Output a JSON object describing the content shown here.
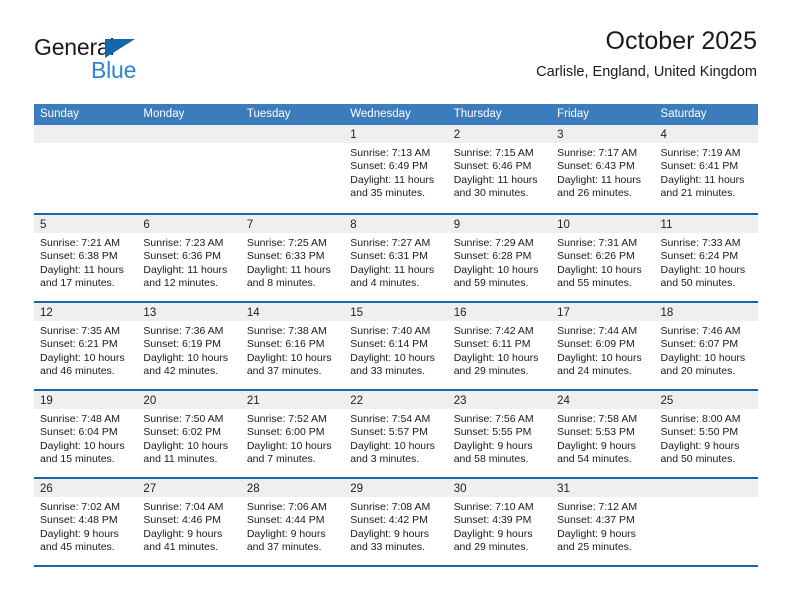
{
  "brand": {
    "word_one": "General",
    "word_two": "Blue",
    "triangle_icon": "triangle-logo-icon",
    "colors": {
      "dark_blue": "#1567ac",
      "light_blue": "#2f82d4"
    }
  },
  "header": {
    "title": "October 2025",
    "subtitle": "Carlisle, England, United Kingdom"
  },
  "calendar": {
    "accent_color": "#1567ac",
    "weekday_header_color": "#3b7cbd",
    "daynum_band_color": "#efefef",
    "weekdays": [
      "Sunday",
      "Monday",
      "Tuesday",
      "Wednesday",
      "Thursday",
      "Friday",
      "Saturday"
    ],
    "weeks": [
      [
        {
          "day": "",
          "sunrise": "",
          "sunset": "",
          "daylight": "",
          "empty": true
        },
        {
          "day": "",
          "sunrise": "",
          "sunset": "",
          "daylight": "",
          "empty": true
        },
        {
          "day": "",
          "sunrise": "",
          "sunset": "",
          "daylight": "",
          "empty": true
        },
        {
          "day": "1",
          "sunrise": "Sunrise: 7:13 AM",
          "sunset": "Sunset: 6:49 PM",
          "daylight": "Daylight: 11 hours and 35 minutes."
        },
        {
          "day": "2",
          "sunrise": "Sunrise: 7:15 AM",
          "sunset": "Sunset: 6:46 PM",
          "daylight": "Daylight: 11 hours and 30 minutes."
        },
        {
          "day": "3",
          "sunrise": "Sunrise: 7:17 AM",
          "sunset": "Sunset: 6:43 PM",
          "daylight": "Daylight: 11 hours and 26 minutes."
        },
        {
          "day": "4",
          "sunrise": "Sunrise: 7:19 AM",
          "sunset": "Sunset: 6:41 PM",
          "daylight": "Daylight: 11 hours and 21 minutes."
        }
      ],
      [
        {
          "day": "5",
          "sunrise": "Sunrise: 7:21 AM",
          "sunset": "Sunset: 6:38 PM",
          "daylight": "Daylight: 11 hours and 17 minutes."
        },
        {
          "day": "6",
          "sunrise": "Sunrise: 7:23 AM",
          "sunset": "Sunset: 6:36 PM",
          "daylight": "Daylight: 11 hours and 12 minutes."
        },
        {
          "day": "7",
          "sunrise": "Sunrise: 7:25 AM",
          "sunset": "Sunset: 6:33 PM",
          "daylight": "Daylight: 11 hours and 8 minutes."
        },
        {
          "day": "8",
          "sunrise": "Sunrise: 7:27 AM",
          "sunset": "Sunset: 6:31 PM",
          "daylight": "Daylight: 11 hours and 4 minutes."
        },
        {
          "day": "9",
          "sunrise": "Sunrise: 7:29 AM",
          "sunset": "Sunset: 6:28 PM",
          "daylight": "Daylight: 10 hours and 59 minutes."
        },
        {
          "day": "10",
          "sunrise": "Sunrise: 7:31 AM",
          "sunset": "Sunset: 6:26 PM",
          "daylight": "Daylight: 10 hours and 55 minutes."
        },
        {
          "day": "11",
          "sunrise": "Sunrise: 7:33 AM",
          "sunset": "Sunset: 6:24 PM",
          "daylight": "Daylight: 10 hours and 50 minutes."
        }
      ],
      [
        {
          "day": "12",
          "sunrise": "Sunrise: 7:35 AM",
          "sunset": "Sunset: 6:21 PM",
          "daylight": "Daylight: 10 hours and 46 minutes."
        },
        {
          "day": "13",
          "sunrise": "Sunrise: 7:36 AM",
          "sunset": "Sunset: 6:19 PM",
          "daylight": "Daylight: 10 hours and 42 minutes."
        },
        {
          "day": "14",
          "sunrise": "Sunrise: 7:38 AM",
          "sunset": "Sunset: 6:16 PM",
          "daylight": "Daylight: 10 hours and 37 minutes."
        },
        {
          "day": "15",
          "sunrise": "Sunrise: 7:40 AM",
          "sunset": "Sunset: 6:14 PM",
          "daylight": "Daylight: 10 hours and 33 minutes."
        },
        {
          "day": "16",
          "sunrise": "Sunrise: 7:42 AM",
          "sunset": "Sunset: 6:11 PM",
          "daylight": "Daylight: 10 hours and 29 minutes."
        },
        {
          "day": "17",
          "sunrise": "Sunrise: 7:44 AM",
          "sunset": "Sunset: 6:09 PM",
          "daylight": "Daylight: 10 hours and 24 minutes."
        },
        {
          "day": "18",
          "sunrise": "Sunrise: 7:46 AM",
          "sunset": "Sunset: 6:07 PM",
          "daylight": "Daylight: 10 hours and 20 minutes."
        }
      ],
      [
        {
          "day": "19",
          "sunrise": "Sunrise: 7:48 AM",
          "sunset": "Sunset: 6:04 PM",
          "daylight": "Daylight: 10 hours and 15 minutes."
        },
        {
          "day": "20",
          "sunrise": "Sunrise: 7:50 AM",
          "sunset": "Sunset: 6:02 PM",
          "daylight": "Daylight: 10 hours and 11 minutes."
        },
        {
          "day": "21",
          "sunrise": "Sunrise: 7:52 AM",
          "sunset": "Sunset: 6:00 PM",
          "daylight": "Daylight: 10 hours and 7 minutes."
        },
        {
          "day": "22",
          "sunrise": "Sunrise: 7:54 AM",
          "sunset": "Sunset: 5:57 PM",
          "daylight": "Daylight: 10 hours and 3 minutes."
        },
        {
          "day": "23",
          "sunrise": "Sunrise: 7:56 AM",
          "sunset": "Sunset: 5:55 PM",
          "daylight": "Daylight: 9 hours and 58 minutes."
        },
        {
          "day": "24",
          "sunrise": "Sunrise: 7:58 AM",
          "sunset": "Sunset: 5:53 PM",
          "daylight": "Daylight: 9 hours and 54 minutes."
        },
        {
          "day": "25",
          "sunrise": "Sunrise: 8:00 AM",
          "sunset": "Sunset: 5:50 PM",
          "daylight": "Daylight: 9 hours and 50 minutes."
        }
      ],
      [
        {
          "day": "26",
          "sunrise": "Sunrise: 7:02 AM",
          "sunset": "Sunset: 4:48 PM",
          "daylight": "Daylight: 9 hours and 45 minutes."
        },
        {
          "day": "27",
          "sunrise": "Sunrise: 7:04 AM",
          "sunset": "Sunset: 4:46 PM",
          "daylight": "Daylight: 9 hours and 41 minutes."
        },
        {
          "day": "28",
          "sunrise": "Sunrise: 7:06 AM",
          "sunset": "Sunset: 4:44 PM",
          "daylight": "Daylight: 9 hours and 37 minutes."
        },
        {
          "day": "29",
          "sunrise": "Sunrise: 7:08 AM",
          "sunset": "Sunset: 4:42 PM",
          "daylight": "Daylight: 9 hours and 33 minutes."
        },
        {
          "day": "30",
          "sunrise": "Sunrise: 7:10 AM",
          "sunset": "Sunset: 4:39 PM",
          "daylight": "Daylight: 9 hours and 29 minutes."
        },
        {
          "day": "31",
          "sunrise": "Sunrise: 7:12 AM",
          "sunset": "Sunset: 4:37 PM",
          "daylight": "Daylight: 9 hours and 25 minutes."
        },
        {
          "day": "",
          "sunrise": "",
          "sunset": "",
          "daylight": "",
          "empty": true
        }
      ]
    ]
  }
}
